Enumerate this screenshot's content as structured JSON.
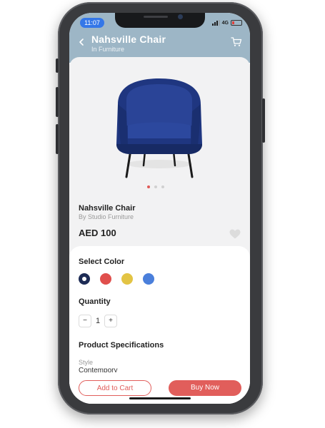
{
  "status_bar": {
    "time": "11:07",
    "network": "4G"
  },
  "header": {
    "title": "Nahsville Chair",
    "subtitle": "In Furniture"
  },
  "product": {
    "name": "Nahsville Chair",
    "brand": "By Studio Furniture",
    "price": "AED 100",
    "image_icon": "blue-armchair",
    "carousel_pages": 3,
    "carousel_active_index": 0
  },
  "colors": {
    "title": "Select Color",
    "options": [
      {
        "hex": "#1d2b55",
        "selected": true
      },
      {
        "hex": "#e04f4c",
        "selected": false
      },
      {
        "hex": "#e3c444",
        "selected": false
      },
      {
        "hex": "#4a7fdb",
        "selected": false
      }
    ]
  },
  "quantity": {
    "title": "Quantity",
    "minus": "−",
    "value": "1",
    "plus": "+"
  },
  "specs": {
    "title": "Product Specifications",
    "style_label": "Style",
    "style_value": "Contempory"
  },
  "actions": {
    "add_to_cart": "Add to Cart",
    "buy_now": "Buy Now"
  },
  "theme": {
    "header": "#9db6c6",
    "accent": "#e15e5b",
    "time_pill": "#3477e8"
  }
}
